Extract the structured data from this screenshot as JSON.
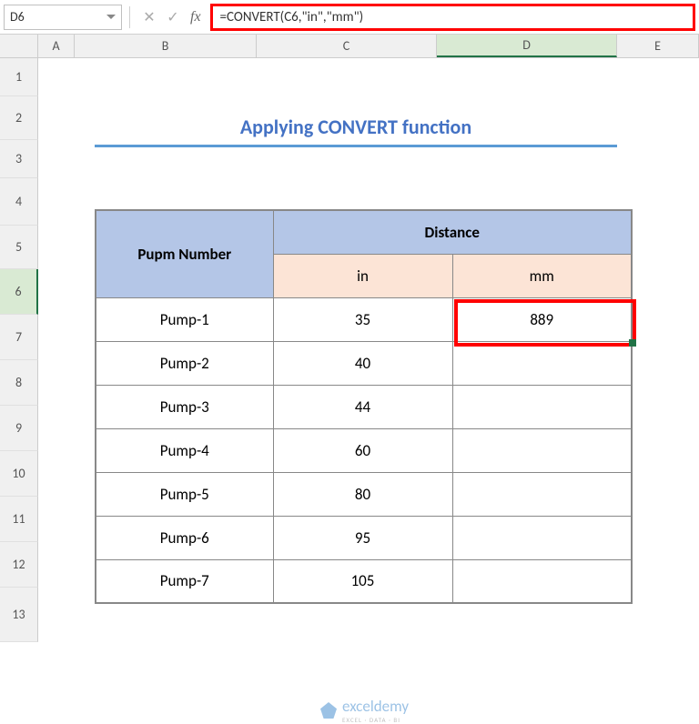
{
  "formula_bar": {
    "name_box": "D6",
    "formula": "=CONVERT(C6,\"in\",\"mm\")",
    "fx_label": "fx"
  },
  "columns": {
    "A": "A",
    "B": "B",
    "C": "C",
    "D": "D",
    "E": "E"
  },
  "rows": {
    "r1": "1",
    "r2": "2",
    "r3": "3",
    "r4": "4",
    "r5": "5",
    "r6": "6",
    "r7": "7",
    "r8": "8",
    "r9": "9",
    "r10": "10",
    "r11": "11",
    "r12": "12",
    "r13": "13"
  },
  "title": "Applying CONVERT function",
  "table": {
    "headers": {
      "pump": "Pupm Number",
      "distance": "Distance",
      "in": "in",
      "mm": "mm"
    },
    "rows": [
      {
        "name": "Pump-1",
        "in": "35",
        "mm": "889"
      },
      {
        "name": "Pump-2",
        "in": "40",
        "mm": ""
      },
      {
        "name": "Pump-3",
        "in": "44",
        "mm": ""
      },
      {
        "name": "Pump-4",
        "in": "60",
        "mm": ""
      },
      {
        "name": "Pump-5",
        "in": "80",
        "mm": ""
      },
      {
        "name": "Pump-6",
        "in": "95",
        "mm": ""
      },
      {
        "name": "Pump-7",
        "in": "105",
        "mm": ""
      }
    ]
  },
  "watermark": {
    "brand": "exceldemy",
    "tagline": "EXCEL · DATA · BI"
  },
  "icons": {
    "cancel": "✕",
    "confirm": "✓"
  }
}
